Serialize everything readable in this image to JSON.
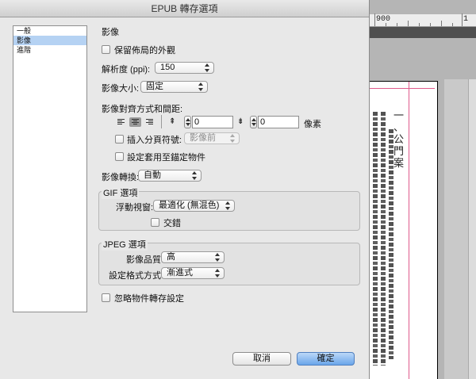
{
  "window": {
    "title": "EPUB 轉存選項"
  },
  "categories": [
    {
      "label": "一般",
      "selected": false
    },
    {
      "label": "影像",
      "selected": true
    },
    {
      "label": "進階",
      "selected": false
    }
  ],
  "image_section": {
    "title": "影像",
    "preserve_appearance": {
      "label": "保留佈局的外觀",
      "checked": false
    },
    "resolution": {
      "label": "解析度 (ppi):",
      "value": "150"
    },
    "image_size": {
      "label": "影像大小:",
      "value": "固定"
    },
    "alignment": {
      "label": "影像對齊方式和間距:",
      "left_value": "0",
      "right_value": "0",
      "unit": "像素",
      "selected_align": "center"
    },
    "page_break": {
      "label": "插入分頁符號:",
      "value": "影像前",
      "checked": false
    },
    "apply_to_anchored": {
      "label": "設定套用至錨定物件",
      "checked": false
    },
    "conversion": {
      "label": "影像轉換:",
      "value": "自動"
    }
  },
  "gif_options": {
    "title": "GIF 選項",
    "palette": {
      "label": "浮動視窗:",
      "value": "最適化 (無混色)"
    },
    "interlace": {
      "label": "交錯",
      "checked": false
    }
  },
  "jpeg_options": {
    "title": "JPEG 選項",
    "quality": {
      "label": "影像品質:",
      "value": "高"
    },
    "format": {
      "label": "設定格式方式:",
      "value": "漸進式"
    }
  },
  "ignore_object_settings": {
    "label": "忽略物件轉存設定",
    "checked": false
  },
  "buttons": {
    "cancel": "取消",
    "ok": "確定"
  },
  "background": {
    "ruler_mark": "900",
    "ruler_mark2": "1",
    "page_heading": "一、公門案"
  },
  "colors": {
    "accent": "#6aa6ea",
    "selection": "#b5d2f3",
    "margin_guide": "#e05a8c"
  }
}
